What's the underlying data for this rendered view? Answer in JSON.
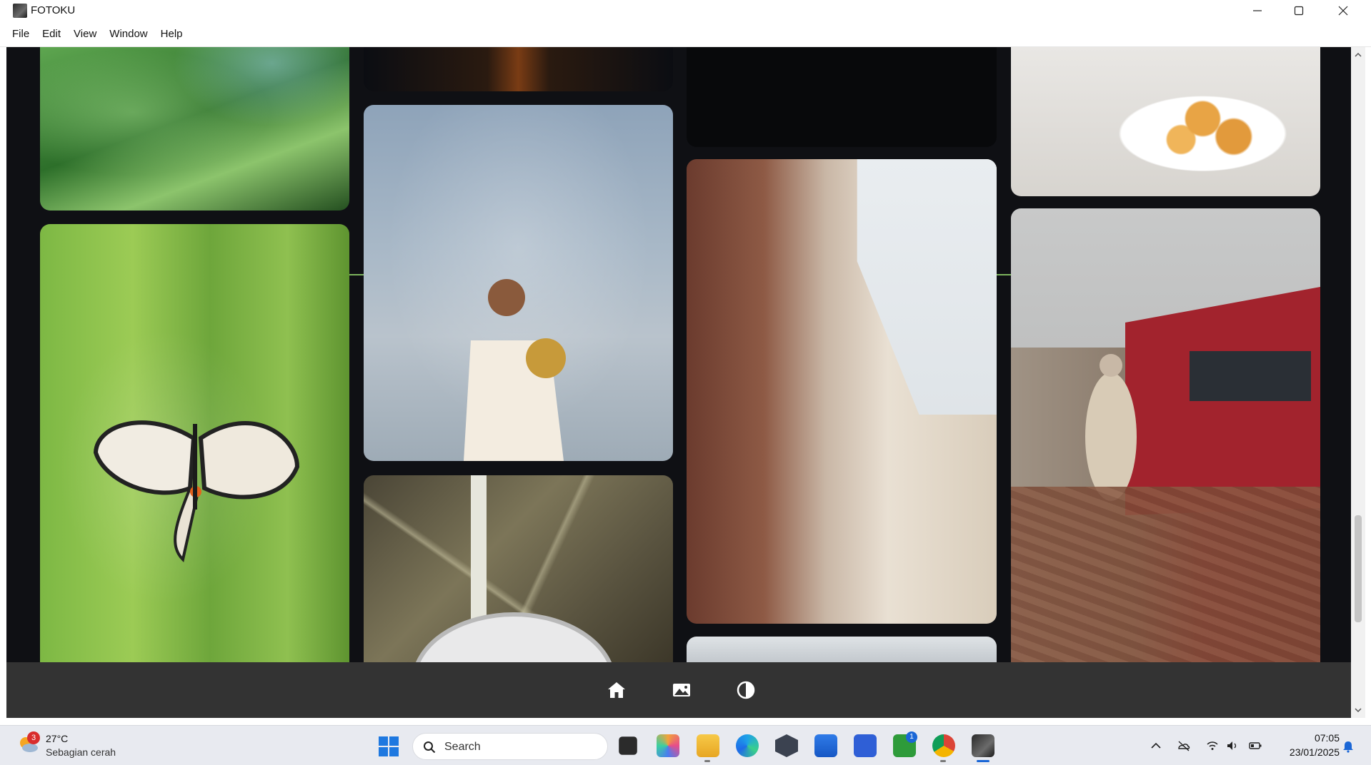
{
  "window": {
    "title": "FOTOKU",
    "minimize": "minimize",
    "maximize": "maximize",
    "close": "close"
  },
  "menu": [
    "File",
    "Edit",
    "View",
    "Window",
    "Help"
  ],
  "gallery": {
    "photos": [
      {
        "id": "grass",
        "subject": "green grass"
      },
      {
        "id": "butterfly",
        "subject": "butterfly on lavender"
      },
      {
        "id": "city",
        "subject": "city at night"
      },
      {
        "id": "man",
        "subject": "man holding dried flowers"
      },
      {
        "id": "clock",
        "subject": "station clock"
      },
      {
        "id": "dark",
        "subject": "dark object"
      },
      {
        "id": "building",
        "subject": "Paris buildings"
      },
      {
        "id": "trees",
        "subject": "bare trees"
      },
      {
        "id": "food",
        "subject": "bowl of pastries"
      },
      {
        "id": "train",
        "subject": "red tram and pedestrian"
      }
    ]
  },
  "bottom_nav": {
    "items": [
      {
        "name": "home",
        "icon": "home-icon"
      },
      {
        "name": "gallery",
        "icon": "image-icon"
      },
      {
        "name": "theme",
        "icon": "contrast-icon"
      }
    ]
  },
  "taskbar": {
    "weather": {
      "badge": "3",
      "temp": "27°C",
      "desc": "Sebagian cerah"
    },
    "search_label": "Search",
    "apps": [
      {
        "name": "task-view",
        "badge": ""
      },
      {
        "name": "copilot",
        "badge": ""
      },
      {
        "name": "file-explorer",
        "badge": ""
      },
      {
        "name": "edge",
        "badge": ""
      },
      {
        "name": "app-cube",
        "badge": ""
      },
      {
        "name": "microsoft-store",
        "badge": ""
      },
      {
        "name": "app-blue",
        "badge": ""
      },
      {
        "name": "xbox",
        "badge": "1"
      },
      {
        "name": "chrome",
        "badge": ""
      },
      {
        "name": "fotoku",
        "badge": ""
      }
    ],
    "clock": {
      "time": "07:05",
      "date": "23/01/2025"
    }
  },
  "colors": {
    "content_bg": "#0f1014",
    "nav_bg": "#333333",
    "accent": "#8fd06a",
    "taskbar_bg": "#e8eaf0"
  }
}
